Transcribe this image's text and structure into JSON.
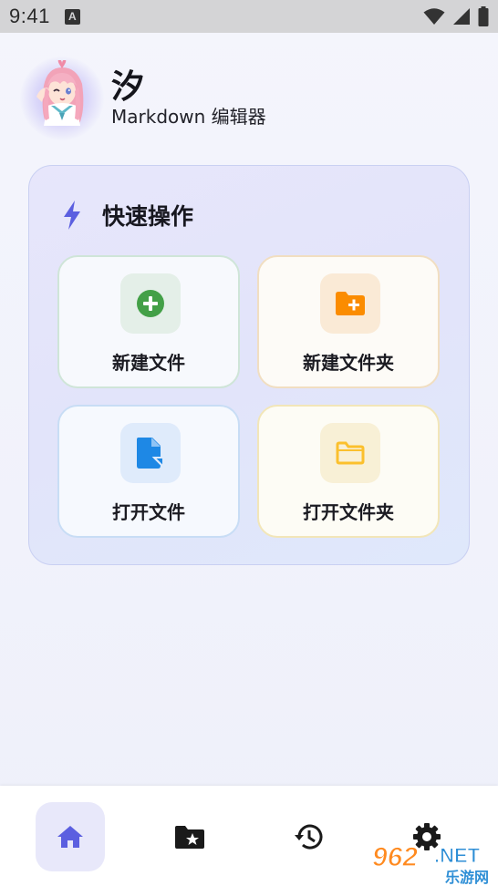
{
  "status_bar": {
    "time": "9:41",
    "notification_icon": "a-letter-icon",
    "icons": [
      "wifi-icon",
      "signal-icon",
      "battery-icon"
    ]
  },
  "header": {
    "title": "汐",
    "subtitle": "Markdown 编辑器",
    "avatar": "anime-girl-avatar"
  },
  "quick_actions": {
    "title": "快速操作",
    "icon": "bolt-icon",
    "tiles": [
      {
        "label": "新建文件",
        "icon": "add-circle-icon",
        "color": "#43a047"
      },
      {
        "label": "新建文件夹",
        "icon": "folder-plus-icon",
        "color": "#fb8c00"
      },
      {
        "label": "打开文件",
        "icon": "file-open-icon",
        "color": "#1e88e5"
      },
      {
        "label": "打开文件夹",
        "icon": "folder-icon",
        "color": "#fbc02d"
      }
    ]
  },
  "bottom_nav": {
    "items": [
      {
        "name": "home",
        "icon": "home-icon",
        "active": true
      },
      {
        "name": "favorites",
        "icon": "folder-star-icon",
        "active": false
      },
      {
        "name": "history",
        "icon": "history-icon",
        "active": false
      },
      {
        "name": "settings",
        "icon": "gear-icon",
        "active": false
      }
    ]
  },
  "watermark": {
    "brand": "962",
    "suffix": ".NET",
    "tagline": "乐游网"
  },
  "colors": {
    "accent": "#5b5fe0",
    "nav_active_bg": "#e8e8fa"
  }
}
